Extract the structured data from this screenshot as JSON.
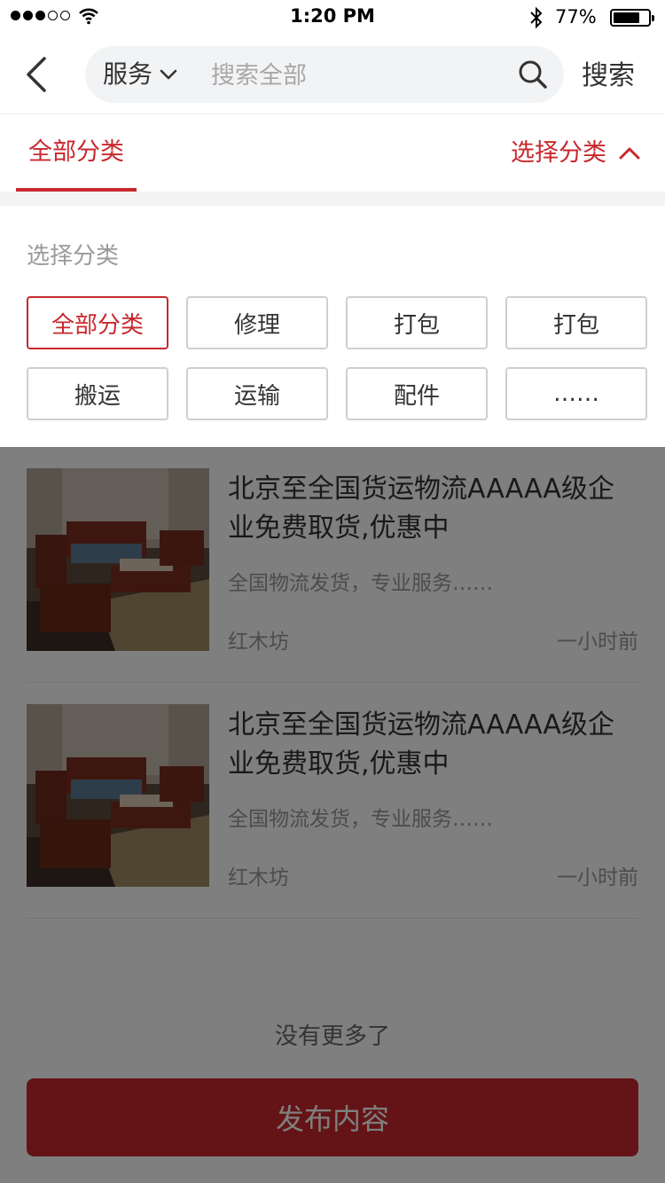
{
  "status_bar": {
    "time": "1:20 PM",
    "battery": "77%"
  },
  "search": {
    "scope_label": "服务",
    "placeholder": "搜索全部",
    "button_label": "搜索"
  },
  "tabs": {
    "all": "全部分类",
    "select": "选择分类"
  },
  "category_panel": {
    "title": "选择分类",
    "options": [
      "全部分类",
      "修理",
      "打包",
      "打包",
      "搬运",
      "运输",
      "配件",
      "……"
    ],
    "selected": "全部分类"
  },
  "listings": [
    {
      "title": "北京至全国货运物流AAAAA级企业免费取货,优惠中",
      "description": "全国物流发货，专业服务……",
      "source": "红木坊",
      "time": "一小时前"
    },
    {
      "title": "北京至全国货运物流AAAAA级企业免费取货,优惠中",
      "description": "全国物流发货，专业服务……",
      "source": "红木坊",
      "time": "一小时前"
    }
  ],
  "footer": {
    "no_more": "没有更多了",
    "publish_label": "发布内容"
  },
  "colors": {
    "accent": "#c8282d",
    "overlay": "rgba(0,0,0,0.5)"
  }
}
